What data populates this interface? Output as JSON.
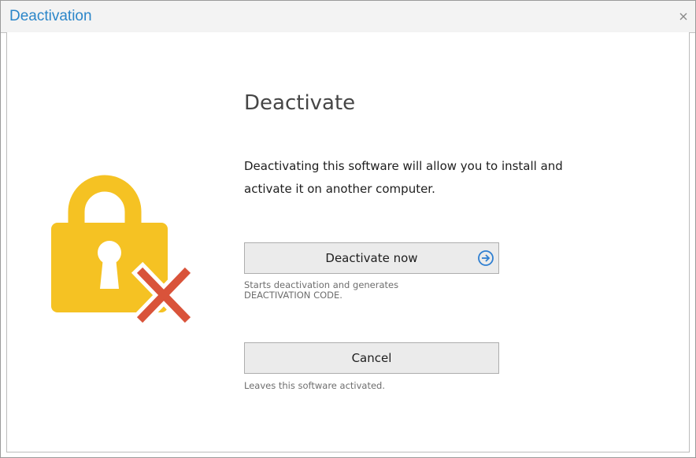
{
  "window": {
    "title": "Deactivation",
    "close_glyph": "×"
  },
  "content": {
    "heading": "Deactivate",
    "description_line1": "Deactivating this software will allow you to install and",
    "description_line2": "activate it on another computer.",
    "deactivate_button": {
      "label": "Deactivate now",
      "icon": "arrow-right-circle-icon",
      "hint_line1": "Starts deactivation and generates",
      "hint_line2": "DEACTIVATION CODE."
    },
    "cancel_button": {
      "label": "Cancel",
      "hint": "Leaves this software activated."
    }
  },
  "icons": {
    "main": "lock-icon",
    "overlay": "red-x-icon"
  },
  "colors": {
    "title_text": "#2b86c9",
    "lock_yellow": "#f5c223",
    "x_red": "#d9533a",
    "arrow_blue": "#2f7fd1"
  }
}
